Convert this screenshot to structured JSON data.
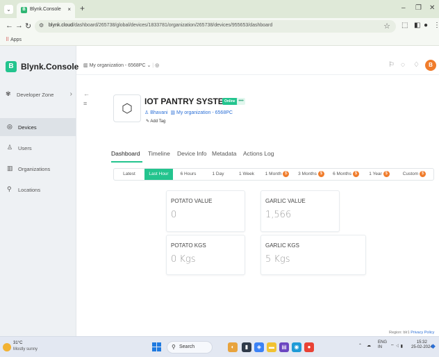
{
  "browser": {
    "tab_title": "Blynk.Console",
    "favicon": "B",
    "close": "×",
    "new_tab": "+",
    "url_host": "blynk.cloud",
    "url_path": "/dashboard/265738/global/devices/1833781/organization/265738/devices/955653/dashboard",
    "bookmarks_apps": "Apps"
  },
  "app": {
    "brand": "Blynk.Console",
    "brand_logo": "B",
    "developer_zone": "Developer Zone",
    "nav": [
      {
        "label": "Devices",
        "icon": "devices-icon"
      },
      {
        "label": "Users",
        "icon": "users-icon"
      },
      {
        "label": "Organizations",
        "icon": "organizations-icon"
      },
      {
        "label": "Locations",
        "icon": "locations-icon"
      }
    ],
    "org_selector": "My organization - 6568PC",
    "avatar_letter": "B"
  },
  "device": {
    "name": "IOT PANTRY SYSTEM",
    "status": "Online",
    "more": "•••",
    "owner": "Bhavani",
    "org": "My organization - 6568PC",
    "add_tag": "Add Tag"
  },
  "tabs": [
    "Dashboard",
    "Timeline",
    "Device Info",
    "Metadata",
    "Actions Log"
  ],
  "ranges": [
    "Latest",
    "Last Hour",
    "6 Hours",
    "1 Day",
    "1 Week",
    "1 Month",
    "3 Months",
    "6 Months",
    "1 Year",
    "Custom"
  ],
  "widgets": [
    {
      "title": "POTATO VALUE",
      "value": "0"
    },
    {
      "title": "GARLIC VALUE",
      "value": "1,566"
    },
    {
      "title": "POTATO KGS",
      "value": "0 Kgs"
    },
    {
      "title": "GARLIC KGS",
      "value": "5 Kgs"
    }
  ],
  "footer": {
    "region": "Region: blr1",
    "privacy": "Privacy Policy"
  },
  "taskbar": {
    "temp": "31°C",
    "condition": "Mostly sunny",
    "search": "Search",
    "lang": "ENG",
    "lang2": "IN",
    "time": "15:32",
    "date": "25-02-2024"
  },
  "colors": {
    "accent": "#23c48e",
    "link": "#2b6fd6",
    "warning": "#f07c2b"
  }
}
